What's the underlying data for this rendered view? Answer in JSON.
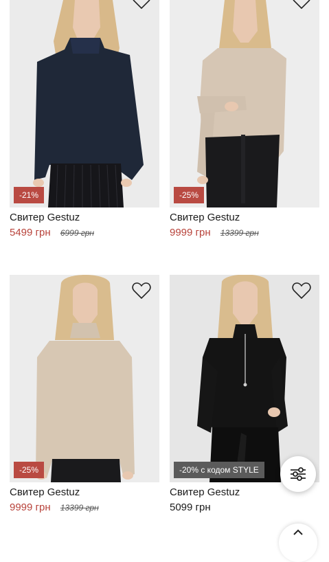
{
  "products": [
    {
      "title": "Свитер Gestuz",
      "price": "5499 грн",
      "old_price": "6999 грн",
      "badge": "-21%"
    },
    {
      "title": "Свитер Gestuz",
      "price": "9999 грн",
      "old_price": "13399 грн",
      "badge": "-25%"
    },
    {
      "title": "Свитер Gestuz",
      "price": "9999 грн",
      "old_price": "13399 грн",
      "badge": "-25%"
    },
    {
      "title": "Свитер Gestuz",
      "price": "5099 грн",
      "old_price": "",
      "badge": "-20% с кодом STYLE"
    }
  ],
  "icons": {
    "favorite": "heart-outline-icon",
    "filter": "sliders-icon",
    "scroll_top": "chevron-up-icon",
    "close": "close-icon"
  },
  "colors": {
    "sale_badge": "#b94a42",
    "promo_badge": "#5b5b5b",
    "sale_price": "#b8433b"
  }
}
